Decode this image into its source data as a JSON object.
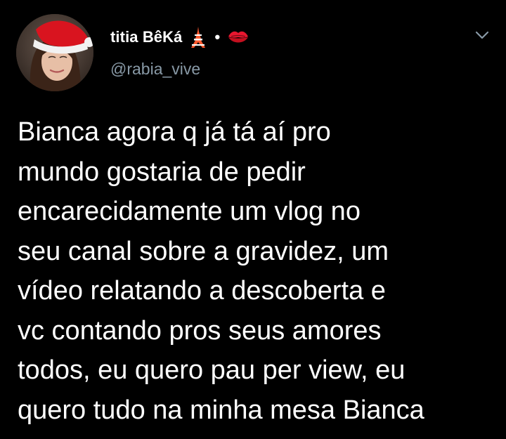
{
  "tweet": {
    "author": {
      "display_name": "titia BêKá",
      "name_emojis": [
        "tokyo-tower-icon",
        "kiss-mark-icon"
      ],
      "separator": "•",
      "handle": "@rabia_vive",
      "avatar": "avatar-photo-santa-hat"
    },
    "menu_icon": "chevron-down-icon",
    "text_lines": [
      "Bianca agora q já tá aí pro",
      "mundo gostaria de pedir",
      "encarecidamente um vlog no",
      "seu canal sobre a gravidez, um",
      "vídeo relatando a descoberta e",
      "vc contando pros seus amores",
      "todos, eu quero pau per view, eu",
      "quero tudo na minha mesa Bianca"
    ]
  },
  "colors": {
    "background": "#000000",
    "text": "#ffffff",
    "handle": "#8899a6",
    "tower": "#ff5a2f",
    "kiss": "#e8172f",
    "santa_hat": "#d9141f"
  }
}
